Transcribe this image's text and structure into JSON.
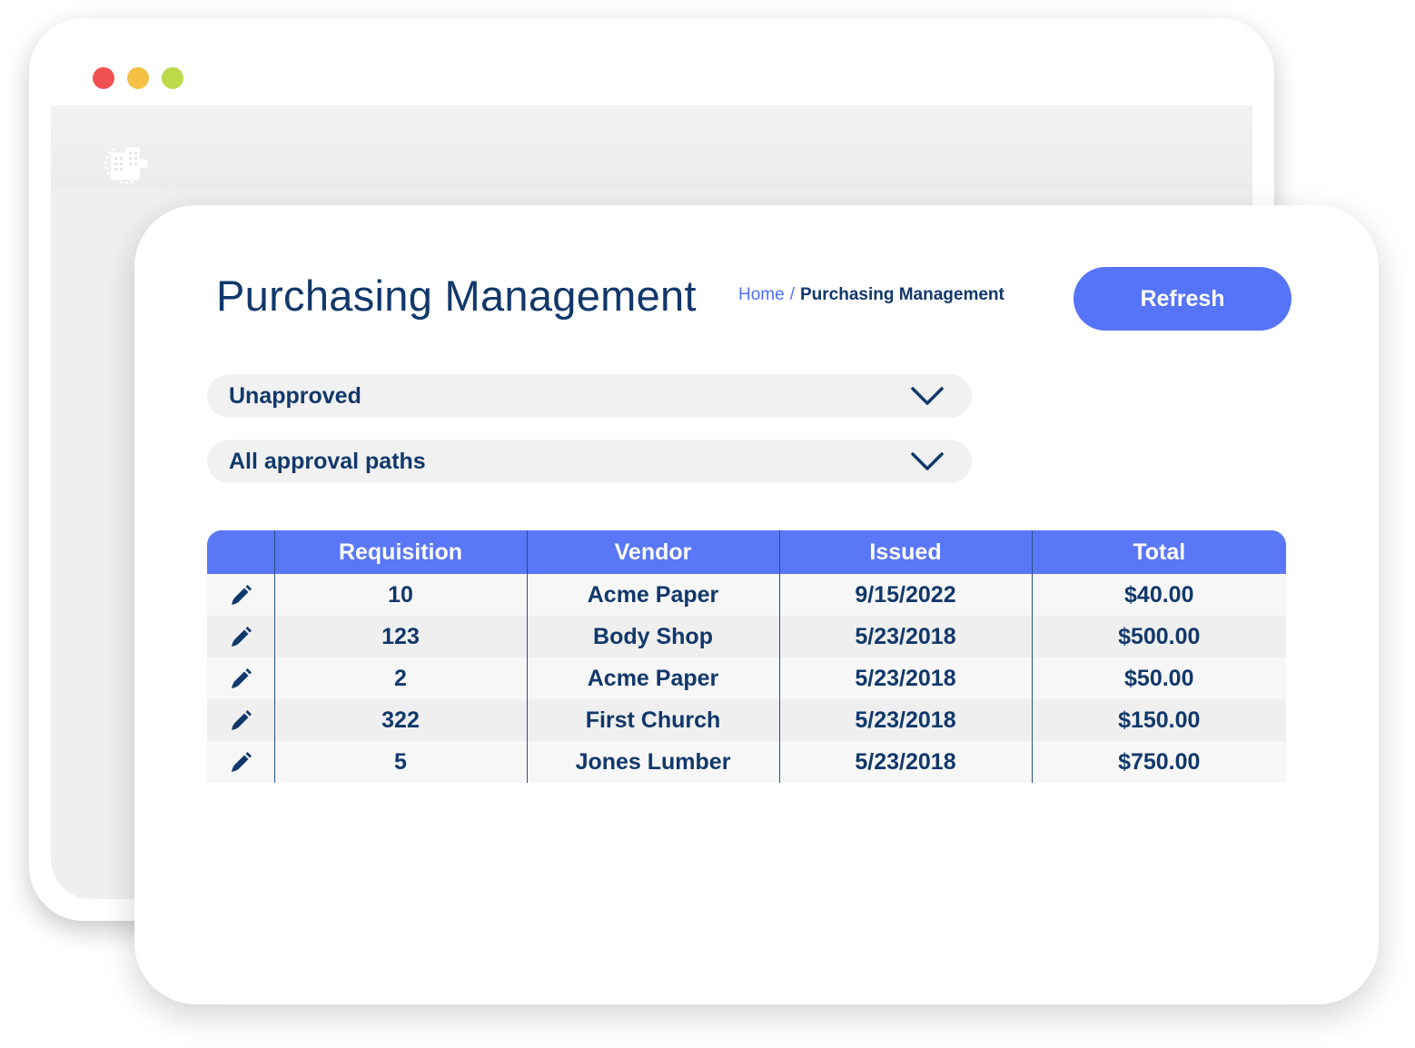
{
  "window": {
    "controls": {
      "close_color": "#f25151",
      "minimize_color": "#f5c145",
      "maximize_color": "#bcd94a"
    },
    "logo_icon": "building-logo-icon"
  },
  "header": {
    "title": "Purchasing Management",
    "breadcrumb": {
      "home": "Home",
      "separator": "/",
      "current": "Purchasing Management"
    },
    "refresh_label": "Refresh"
  },
  "filters": {
    "status": {
      "selected": "Unapproved",
      "icon": "chevron-down-icon"
    },
    "approval_path": {
      "selected": "All approval paths",
      "icon": "chevron-down-icon"
    }
  },
  "table": {
    "columns": [
      "",
      "Requisition",
      "Vendor",
      "Issued",
      "Total"
    ],
    "row_icon": "pencil-edit-icon",
    "rows": [
      {
        "requisition": "10",
        "vendor": "Acme Paper",
        "issued": "9/15/2022",
        "total": "$40.00"
      },
      {
        "requisition": "123",
        "vendor": "Body Shop",
        "issued": "5/23/2018",
        "total": "$500.00"
      },
      {
        "requisition": "2",
        "vendor": "Acme Paper",
        "issued": "5/23/2018",
        "total": "$50.00"
      },
      {
        "requisition": "322",
        "vendor": "First Church",
        "issued": "5/23/2018",
        "total": "$150.00"
      },
      {
        "requisition": "5",
        "vendor": "Jones Lumber",
        "issued": "5/23/2018",
        "total": "$750.00"
      }
    ]
  },
  "colors": {
    "accent": "#5674f7",
    "text_primary": "#11386b",
    "link": "#4f6ff5"
  }
}
